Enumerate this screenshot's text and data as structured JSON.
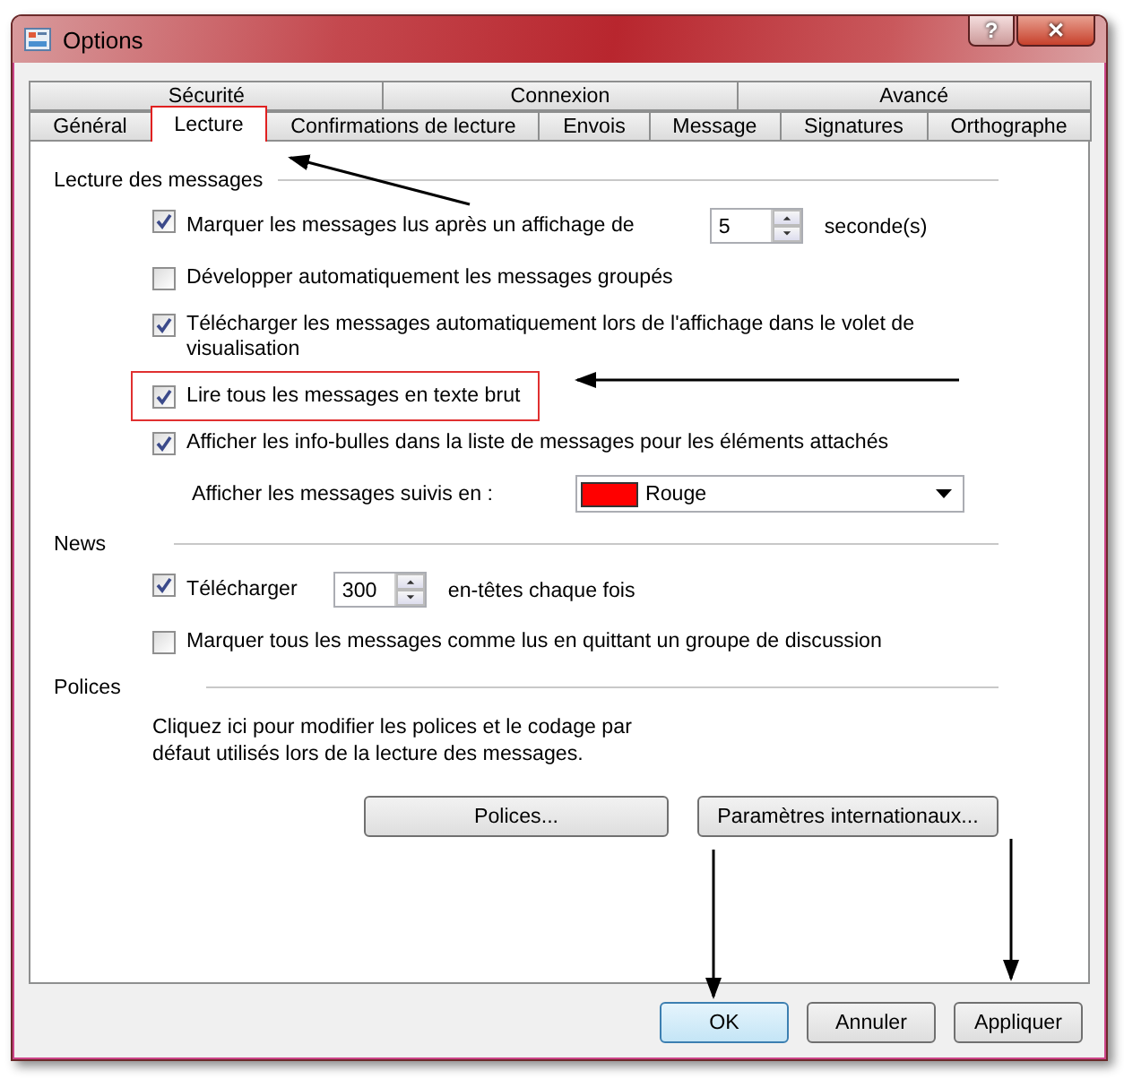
{
  "window": {
    "title": "Options",
    "title_buttons": [
      {
        "kind": "help",
        "label": "?"
      },
      {
        "kind": "close",
        "label": "✕"
      }
    ]
  },
  "tab_rows": [
    [
      {
        "label": "Sécurité",
        "selected": false,
        "highlighted": false
      },
      {
        "label": "Connexion",
        "selected": false,
        "highlighted": false
      },
      {
        "label": "Avancé",
        "selected": false,
        "highlighted": false
      }
    ],
    [
      {
        "label": "Général",
        "selected": false,
        "highlighted": false
      },
      {
        "label": "Lecture",
        "selected": true,
        "highlighted": true
      },
      {
        "label": "Confirmations de lecture",
        "selected": false,
        "highlighted": false
      },
      {
        "label": "Envois",
        "selected": false,
        "highlighted": false
      },
      {
        "label": "Message",
        "selected": false,
        "highlighted": false
      },
      {
        "label": "Signatures",
        "selected": false,
        "highlighted": false
      },
      {
        "label": "Orthographe",
        "selected": false,
        "highlighted": false
      }
    ]
  ],
  "sections": [
    {
      "title": "Lecture des messages",
      "items": [
        {
          "kind": "checkbox",
          "label": "Marquer les messages lus après un affichage de",
          "checked": true,
          "highlighted": false,
          "spinner": {
            "value": "5",
            "suffix": "seconde(s)"
          }
        },
        {
          "kind": "checkbox",
          "label": "Développer automatiquement les messages groupés",
          "checked": false,
          "highlighted": false
        },
        {
          "kind": "checkbox",
          "label": "Télécharger les messages automatiquement lors de l'affichage dans le volet de visualisation",
          "checked": true,
          "highlighted": false
        },
        {
          "kind": "checkbox",
          "label": "Lire tous les messages en texte brut",
          "checked": true,
          "highlighted": true
        },
        {
          "kind": "checkbox",
          "label": "Afficher les info-bulles dans la liste de messages pour les éléments attachés",
          "checked": true,
          "highlighted": false
        },
        {
          "kind": "select",
          "label": "Afficher les messages suivis en :",
          "value": "Rouge",
          "color": "#ff0000"
        }
      ]
    },
    {
      "title": "News",
      "items": [
        {
          "kind": "checkbox",
          "label": "Télécharger",
          "checked": true,
          "highlighted": false,
          "spinner": {
            "value": "300",
            "suffix": "en-têtes chaque fois"
          }
        },
        {
          "kind": "checkbox",
          "label": "Marquer tous les messages comme lus en quittant un groupe de discussion",
          "checked": false,
          "highlighted": false
        }
      ]
    },
    {
      "title": "Polices",
      "items": [
        {
          "kind": "text",
          "text": "Cliquez ici pour modifier les polices et le codage par défaut utilisés lors de la lecture des messages."
        },
        {
          "kind": "buttons",
          "buttons": [
            "Polices...",
            "Paramètres internationaux..."
          ]
        }
      ]
    }
  ],
  "footer_buttons": [
    {
      "label": "OK",
      "default": true
    },
    {
      "label": "Annuler",
      "default": false
    },
    {
      "label": "Appliquer",
      "default": false
    }
  ]
}
